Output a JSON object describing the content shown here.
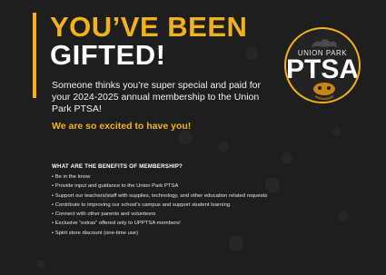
{
  "headline": {
    "line1": "YOU’VE BEEN",
    "line2": "GIFTED!"
  },
  "body_text": "Someone thinks you’re super special and paid for your 2024-2025 annual membership to the Union Park PTSA!",
  "tagline": "We are so excited to have you!",
  "logo": {
    "top_text": "UNION PARK",
    "main_text": "PTSA"
  },
  "benefits": {
    "title": "WHAT ARE THE BENEFITS OF MEMBERSHIP?",
    "items": [
      "• Be in the know",
      "• Provide input and guidance to the Union Park PTSA",
      "• Support our teachers/staff with supplies, technology, and other education related requests",
      "• Contribute to improving our school’s campus and support student learning",
      "• Connect with other parents and volunteers",
      "• Exclusive “extras” offered only to UPPTSA members!",
      "• Spirit store discount (one-time use)"
    ]
  },
  "colors": {
    "background": "#1e1e1e",
    "accent": "#f2b21c",
    "text": "#ffffff"
  }
}
